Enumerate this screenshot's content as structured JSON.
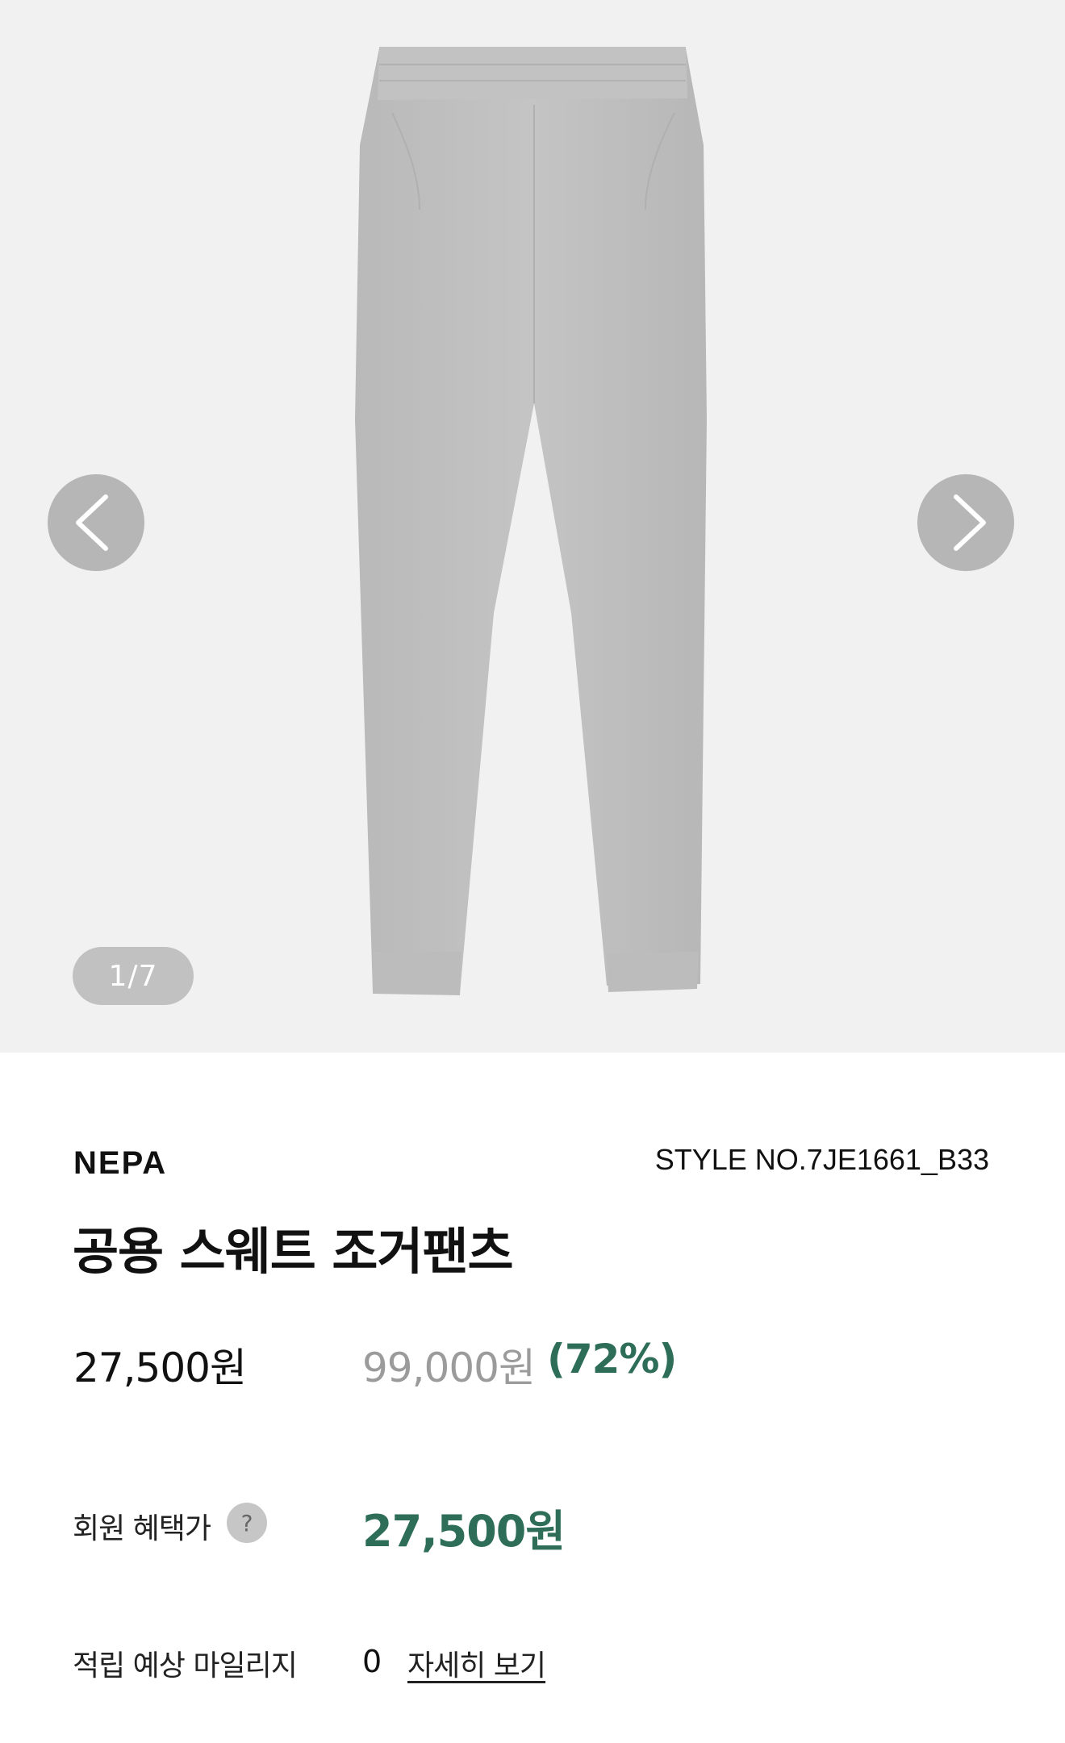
{
  "gallery": {
    "counter": "1/7",
    "background_color": "#f1f1f1",
    "image_subject": "grey-sweat-jogger-pants",
    "prev_icon": "chevron-left-icon",
    "next_icon": "chevron-right-icon"
  },
  "product": {
    "brand": "NEPA",
    "style_no": "STYLE NO.7JE1661_B33",
    "title": "공용 스웨트 조거팬츠",
    "price": "27,500원",
    "original_price": "99,000원",
    "discount": "(72%)"
  },
  "member": {
    "label": "회원 혜택가",
    "help_icon": "?",
    "price": "27,500원"
  },
  "mileage": {
    "label": "적립 예상 마일리지",
    "value": "0",
    "link_label": "자세히 보기"
  },
  "colors": {
    "accent": "#2e6e59",
    "muted": "#9b9b9b"
  }
}
